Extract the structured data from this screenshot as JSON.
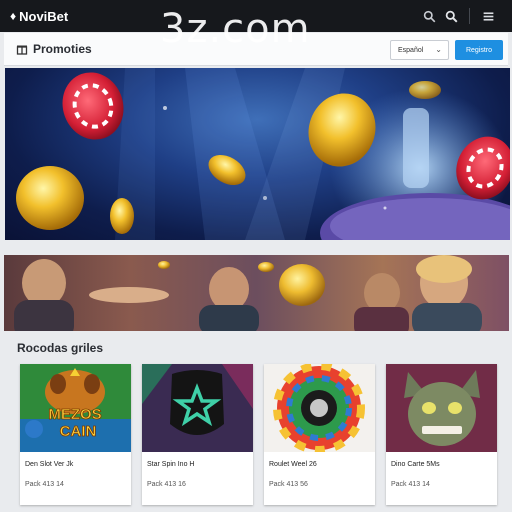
{
  "header": {
    "brand": "NoviBet",
    "icons": [
      "search-icon",
      "zoom-icon",
      "menu-icon"
    ]
  },
  "watermark": "3z.com",
  "promo_bar": {
    "title": "Promoties",
    "language_select": "Español",
    "register_button": "Registro"
  },
  "section": {
    "title": "Rocodas griles"
  },
  "games": [
    {
      "title": "MEZOS CAIN",
      "name": "Den Slot Ver Jk",
      "meta": "Pack 413 14"
    },
    {
      "title": "",
      "name": "Star Spin Ino H",
      "meta": "Pack 413 16"
    },
    {
      "title": "",
      "name": "Roulet Weel 26",
      "meta": "Pack 413 56"
    },
    {
      "title": "",
      "name": "Dino Carte 5Ms",
      "meta": "Pack 413 14"
    }
  ],
  "colors": {
    "topbar": "#16181c",
    "accent": "#1e8fe1",
    "background": "#e9ebee"
  }
}
